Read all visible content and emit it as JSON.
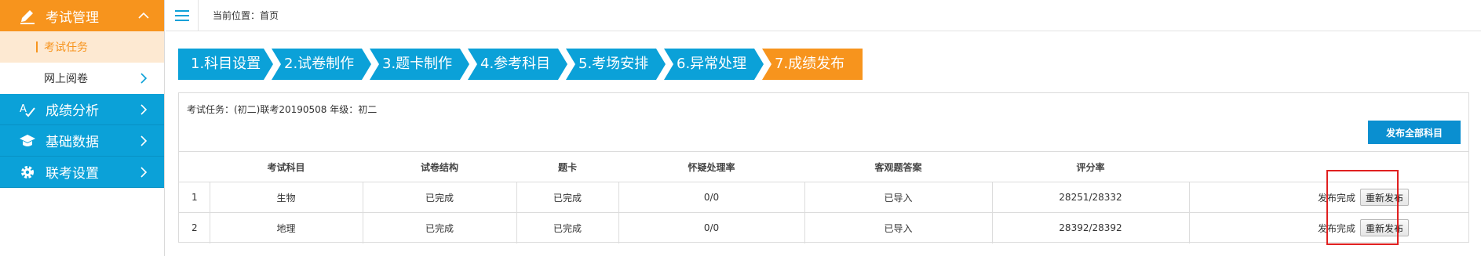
{
  "sidebar": {
    "exam_mgmt": "考试管理",
    "exam_task": "考试任务",
    "online_marking": "网上阅卷",
    "score_analysis": "成绩分析",
    "basic_data": "基础数据",
    "joint_exam": "联考设置"
  },
  "topbar": {
    "breadcrumb": "当前位置：首页"
  },
  "steps": [
    "1.科目设置",
    "2.试卷制作",
    "3.题卡制作",
    "4.参考科目",
    "5.考场安排",
    "6.异常处理",
    "7.成绩发布"
  ],
  "panel": {
    "task_info": "考试任务：(初二)联考20190508   年级：初二",
    "publish_all": "发布全部科目"
  },
  "table": {
    "headers": [
      "",
      "考试科目",
      "试卷结构",
      "题卡",
      "怀疑处理率",
      "客观题答案",
      "评分率",
      ""
    ],
    "rows": [
      {
        "idx": "1",
        "subject": "生物",
        "structure": "已完成",
        "card": "已完成",
        "doubt": "0/0",
        "objective": "已导入",
        "score_rate": "28251/28332",
        "status": "发布完成",
        "action": "重新发布"
      },
      {
        "idx": "2",
        "subject": "地理",
        "structure": "已完成",
        "card": "已完成",
        "doubt": "0/0",
        "objective": "已导入",
        "score_rate": "28392/28392",
        "status": "发布完成",
        "action": "重新发布"
      }
    ]
  },
  "colors": {
    "orange": "#f7941d",
    "blue": "#0ba1d8",
    "highlight": "#e02020"
  }
}
